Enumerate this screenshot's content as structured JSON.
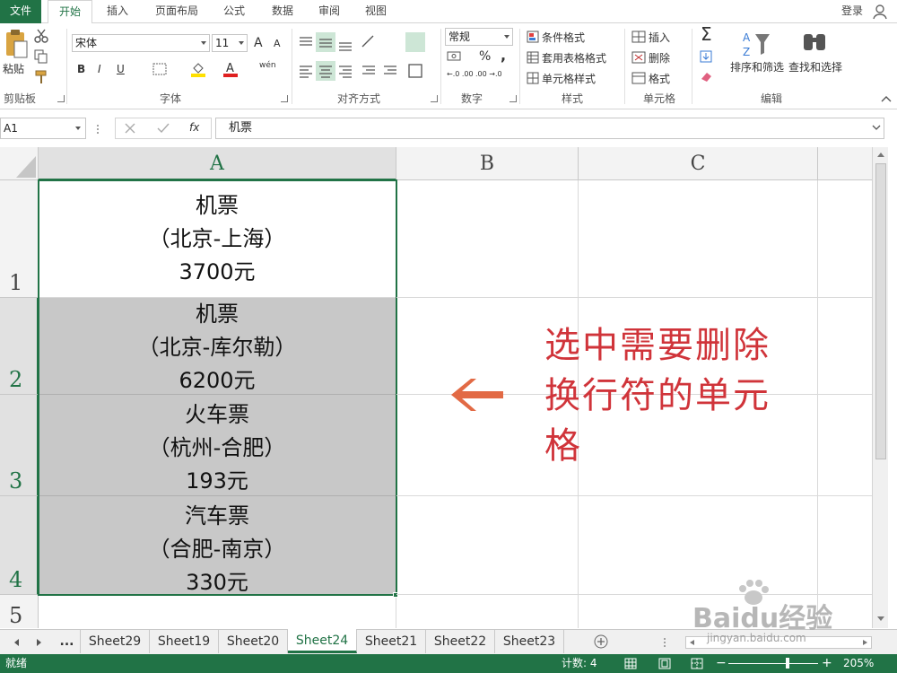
{
  "tabs": {
    "file": "文件",
    "items": [
      "开始",
      "插入",
      "页面布局",
      "公式",
      "数据",
      "审阅",
      "视图"
    ],
    "login": "登录"
  },
  "ribbon": {
    "clipboard": {
      "paste": "粘贴",
      "label": "剪贴板"
    },
    "font": {
      "name": "宋体",
      "size": "11",
      "bold": "B",
      "italic": "I",
      "underline": "U",
      "label": "字体",
      "grow": "A",
      "shrink": "A",
      "phonetic": "wén"
    },
    "alignment": {
      "label": "对齐方式"
    },
    "number": {
      "format": "常规",
      "label": "数字",
      "percent": "%",
      "comma": ",",
      "inc_decimal": "←.0 .00",
      "dec_decimal": ".00 →.0"
    },
    "styles": {
      "conditional": "条件格式",
      "table": "套用表格格式",
      "cell": "单元格样式",
      "label": "样式"
    },
    "cells": {
      "insert": "插入",
      "delete": "删除",
      "format": "格式",
      "label": "单元格"
    },
    "editing": {
      "sort": "排序和筛选",
      "find": "查找和选择",
      "label": "编辑",
      "sum": "Σ"
    }
  },
  "formula_bar": {
    "name_box": "A1",
    "content": "机票",
    "fx": "fx"
  },
  "columns": [
    "A",
    "B",
    "C"
  ],
  "rows": [
    {
      "num": "1",
      "lines": [
        "机票",
        "（北京-上海）",
        "3700元"
      ]
    },
    {
      "num": "2",
      "lines": [
        "机票",
        "（北京-库尔勒）",
        "6200元"
      ]
    },
    {
      "num": "3",
      "lines": [
        "火车票",
        "（杭州-合肥）",
        "193元"
      ]
    },
    {
      "num": "4",
      "lines": [
        "汽车票",
        "（合肥-南京）",
        "330元"
      ]
    },
    {
      "num": "5",
      "lines": []
    }
  ],
  "annotation": {
    "text_lines": [
      "选中需要删除",
      "换行符的单元",
      "格"
    ],
    "color": "#d0343a"
  },
  "sheets": {
    "more": "...",
    "items": [
      "Sheet29",
      "Sheet19",
      "Sheet20",
      "Sheet24",
      "Sheet21",
      "Sheet22",
      "Sheet23"
    ],
    "active": "Sheet24"
  },
  "status": {
    "ready": "就绪",
    "count": "计数: 4",
    "zoom": "205%"
  },
  "watermark": {
    "text": "Baidu经验",
    "url": "jingyan.baidu.com"
  },
  "colors": {
    "accent": "#217346",
    "selection": "#c8c8c8"
  }
}
